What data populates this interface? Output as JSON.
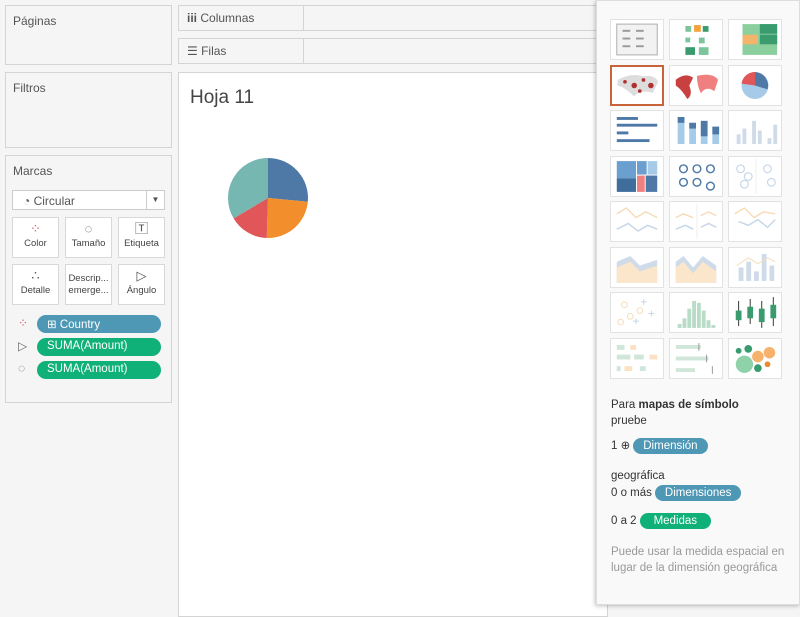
{
  "panes": {
    "pages": "Páginas",
    "filters": "Filtros",
    "marks": "Marcas"
  },
  "shelves": {
    "columns": "Columnas",
    "rows": "Filas"
  },
  "sheet": {
    "title": "Hoja 11"
  },
  "marks": {
    "type": "Circular",
    "buttons": {
      "color": "Color",
      "size": "Tamaño",
      "label": "Etiqueta",
      "detail": "Detalle",
      "tooltip": "Descrip... emerge...",
      "angle": "Ángulo"
    },
    "pills": [
      {
        "icon": "color-icon",
        "label": "Country",
        "kind": "dimension"
      },
      {
        "icon": "angle-icon",
        "label": "SUMA(Amount)",
        "kind": "measure"
      },
      {
        "icon": "size-icon",
        "label": "SUMA(Amount)",
        "kind": "measure"
      }
    ]
  },
  "chart_data": {
    "type": "pie",
    "series": [
      {
        "share": 0.265,
        "color": "#4e79a7"
      },
      {
        "share": 0.24,
        "color": "#f28e2b"
      },
      {
        "share": 0.16,
        "color": "#e15759"
      },
      {
        "share": 0.335,
        "color": "#76b7b2"
      }
    ]
  },
  "show_me": {
    "selected": "symbol-maps",
    "hint": {
      "pre": "Para ",
      "bold": "mapas de símbolo",
      "try": "pruebe",
      "r1_count": "1",
      "r1_tag": "Dimensión",
      "r1_after": "geográfica",
      "r2_count": "0 o más",
      "r2_tag": "Dimensiones",
      "r3_count": "0 a 2",
      "r3_tag": "Medidas",
      "note": "Puede usar la medida espacial en lugar de la dimensión geográfica"
    },
    "colors": {
      "dimension": "#4e98b5",
      "measure": "#10b178",
      "selected": "#c9643a"
    }
  }
}
